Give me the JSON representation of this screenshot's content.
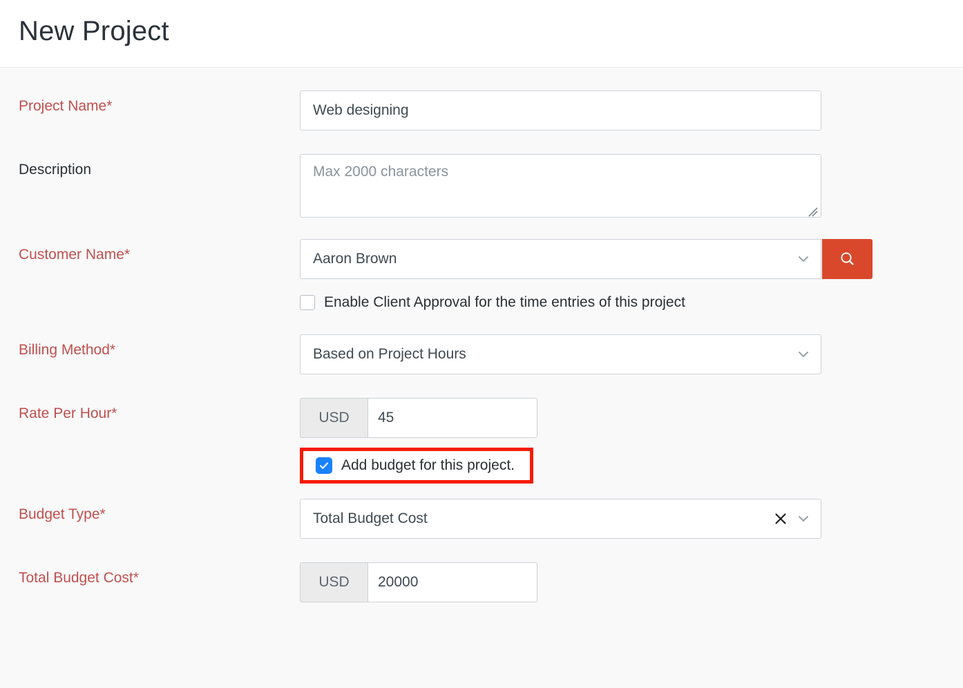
{
  "header": {
    "title": "New Project"
  },
  "form": {
    "project_name": {
      "label": "Project Name*",
      "value": "Web designing",
      "placeholder": ""
    },
    "description": {
      "label": "Description",
      "value": "",
      "placeholder": "Max 2000 characters"
    },
    "customer_name": {
      "label": "Customer Name*",
      "value": "Aaron Brown",
      "search_icon": "search-icon",
      "chevron_icon": "chevron-down-icon"
    },
    "client_approval": {
      "label": "Enable Client Approval for the time entries of this project",
      "checked": false
    },
    "billing_method": {
      "label": "Billing Method*",
      "value": "Based on Project Hours",
      "chevron_icon": "chevron-down-icon"
    },
    "rate_per_hour": {
      "label": "Rate Per Hour*",
      "currency": "USD",
      "value": "45"
    },
    "add_budget": {
      "label": "Add budget for this project.",
      "checked": true,
      "highlight_color": "#f61c00"
    },
    "budget_type": {
      "label": "Budget Type*",
      "value": "Total Budget Cost",
      "clear_icon": "close-icon",
      "chevron_icon": "chevron-down-icon"
    },
    "total_budget_cost": {
      "label": "Total Budget Cost*",
      "currency": "USD",
      "value": "20000"
    }
  },
  "colors": {
    "required_label": "#c0504d",
    "accent_button": "#d9482b",
    "checkbox_checked": "#1a82ff",
    "annotation": "#f61c00"
  }
}
